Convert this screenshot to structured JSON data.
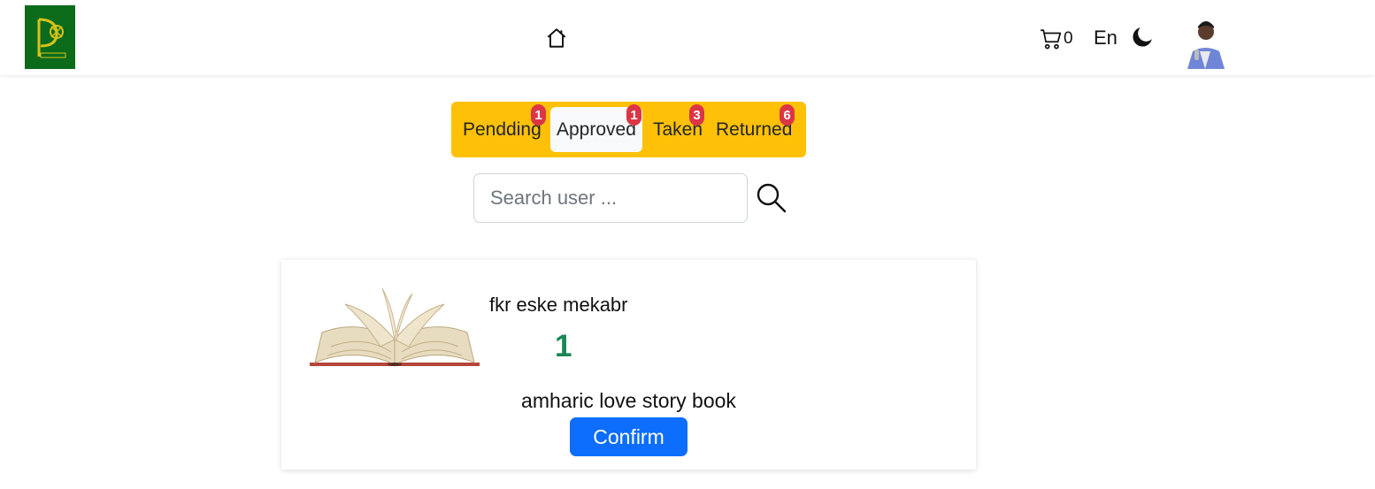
{
  "header": {
    "cart_count": "0",
    "language": "En"
  },
  "tabs": [
    {
      "label": "Pendding",
      "count": "1"
    },
    {
      "label": "Approved",
      "count": "1",
      "active": true
    },
    {
      "label": "Taken",
      "count": "3"
    },
    {
      "label": "Returned",
      "count": "6"
    }
  ],
  "search": {
    "placeholder": "Search user ..."
  },
  "request": {
    "title": "fkr eske mekabr",
    "quantity": "1",
    "description": "amharic love story book",
    "confirm_label": "Confirm"
  },
  "colors": {
    "tabs_bg": "#ffc107",
    "badge": "#dc3545",
    "count": "#198754",
    "primary": "#0d6efd",
    "logo_bg": "#0b6b1a"
  }
}
